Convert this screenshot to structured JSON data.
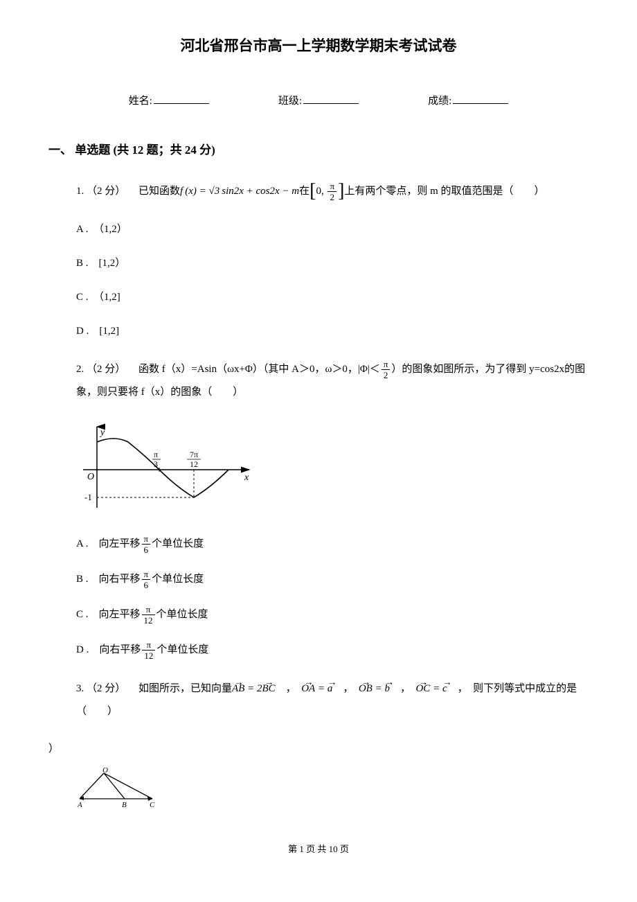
{
  "doc": {
    "title": "河北省邢台市高一上学期数学期末考试试卷",
    "name_label": "姓名:",
    "class_label": "班级:",
    "score_label": "成绩:",
    "section1": "一、 单选题 (共 12 题；共 24 分)",
    "q1": {
      "num": "1.",
      "points": "（2 分）",
      "stem_a": "已知函数",
      "formula": "f(x) = √3 sin2x + cos2x − m",
      "stem_b": "在",
      "interval": "[0, π/2]",
      "stem_c": "上有两个零点，则 m 的取值范围是（　　）",
      "opt_a": "A .　（1,2）",
      "opt_b": "B .　[1,2）",
      "opt_c": "C .　（1,2]",
      "opt_d": "D .　[1,2]"
    },
    "q2": {
      "num": "2.",
      "points": "（2 分）",
      "stem_a": "函数 f（x）=Asin（ωx+Φ）（其中 A＞0，ω＞0，|Φ|＜",
      "stem_b": "）的图象如图所示，为了得到 y=cos2x的图象，则只要将 f（x）的图象（　　）",
      "graph": {
        "x_marks": [
          "π/3",
          "7π/12"
        ],
        "y_mark": "-1",
        "axes": [
          "x",
          "y",
          "O"
        ]
      },
      "opt_a_pre": "A .　向左平移",
      "opt_a_post": "个单位长度",
      "opt_b_pre": "B .　向右平移",
      "opt_b_post": "个单位长度",
      "opt_c_pre": "C .　向左平移",
      "opt_c_post": "个单位长度",
      "opt_d_pre": "D .　向右平移",
      "opt_d_post": "个单位长度",
      "frac_ab": {
        "num": "π",
        "den": "6"
      },
      "frac_cd": {
        "num": "π",
        "den": "12"
      }
    },
    "q3": {
      "num": "3.",
      "points": "（2 分）",
      "stem_a": "如图所示，已知向量",
      "eq1": "AB = 2BC",
      "eq2": "OA = a",
      "eq3": "OB = b",
      "eq4": "OC = c",
      "stem_b": "，　则下列等式中成立的是（　　）",
      "close": "）",
      "tri_labels": [
        "O",
        "A",
        "B",
        "C"
      ]
    },
    "footer": "第 1 页 共 10 页"
  }
}
